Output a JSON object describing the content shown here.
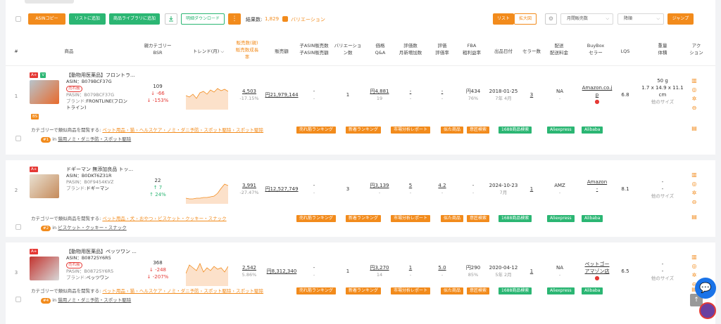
{
  "toolbar": {
    "asin_copy": "ASINコピー",
    "add_list": "リストに追加",
    "add_library": "商品ライブラリに追加",
    "download_icon": "download-icon",
    "detail_download": "明細ダウンロード",
    "more": "⋮",
    "result_label": "結果数:",
    "result_count": "1,829",
    "variation": "バリエーション",
    "view_list": "リスト",
    "view_large": "拡大図",
    "sort_field": "月間販売数",
    "sort_order": "降順",
    "jump": "ジャンプ"
  },
  "headers": {
    "num": "#",
    "product": "商品",
    "parent_bsr": "親カテゴリー",
    "bsr": "BSR",
    "trend": "トレンド(月)",
    "sales_qty": "販売数(親)",
    "sales_growth": "販売数成長",
    "sales_growth2": "率",
    "revenue": "販売額",
    "child_asin": "子ASIN販売数",
    "child_asin2": "子ASIN販売額",
    "variations": "バリエーショ",
    "variations2": "ン数",
    "price": "価格",
    "qa": "Q&A",
    "reviews": "評価数",
    "reviews2": "月新増加数",
    "rating": "評価",
    "rating2": "評価率",
    "fba": "FBA",
    "fba2": "粗利益率",
    "date": "出品日付",
    "sellers": "セラー数",
    "shipping": "配送",
    "shipping2": "配送料金",
    "buybox": "BuyBox",
    "buybox2": "セラー",
    "lqs": "LQS",
    "weight": "重量",
    "weight2": "体積",
    "action": "アク",
    "action2": "ション"
  },
  "rows": [
    {
      "num": "1",
      "badges": [
        "A+",
        "V"
      ],
      "title": "【動物用医薬品】フロントラ...",
      "asin": "ASIN：B079BCF37G",
      "tag": "売れ筋",
      "pasin": "PASIN：B079BCF37G",
      "brand_label": "ブランド:",
      "brand": "FRONTLINE(フロン",
      "brand2": "トライン)",
      "extra": "BS",
      "bsr": "109",
      "bsr_d": "↓ -66",
      "bsr_p": "↓ -153%",
      "sales": "4,503",
      "growth": "-17.15%",
      "revenue": "円21,979,144",
      "child1": "-",
      "child2": "-",
      "var": "1",
      "price": "円4,881",
      "qa": "19",
      "rev": "-",
      "rev2": "-",
      "rate": "-",
      "rate2": "-",
      "fba": "円434",
      "fba2": "76%",
      "date": "2018-01-25",
      "date2": "7年 4月",
      "sellers": "3",
      "ship": "NA",
      "ship2": "-",
      "bb": "Amazon.co.j",
      "bb2": "p",
      "lqs": "6.8",
      "w": "50 g",
      "w2": "1.7 x 14.9 x 11.1",
      "w3": "cm",
      "w4": "他のサイズ",
      "cat_prefix": "カテゴリーで類似商品を閲覧する:",
      "cat_path": "ペット用品 › 猫 › ヘルスケア › ノミ・ダニ予防 › スポット駆除 › スポット駆除",
      "tags": [
        "売れ筋ランキング",
        "新着ランキング",
        "市場分析レポート",
        "似た商品",
        "意匠検索",
        "1688商品検索",
        "Aliexpress",
        "Alibaba"
      ],
      "rank_badge": "#1",
      "rank_in": "in",
      "rank_cat": "猫用ノミ・ダニ予防・スポット駆除"
    },
    {
      "num": "2",
      "badges": [
        "A+"
      ],
      "title": "ドギーマン 無添加良品 トッ...",
      "asin": "ASIN：B0DKT6Z31R",
      "tag": "",
      "pasin": "PASIN：B0F9454KVZ",
      "brand_label": "ブランド:",
      "brand": "ドギーマン",
      "brand2": "",
      "extra": "",
      "bsr": "22",
      "bsr_d": "↑ 7",
      "bsr_p": "↑ 24%",
      "sales": "3,991",
      "growth": "-27.47%",
      "revenue": "円12,527,749",
      "child1": "-",
      "child2": "-",
      "var": "3",
      "price": "円3,139",
      "qa": "-",
      "rev": "5",
      "rev2": "-",
      "rate": "4.2",
      "rate2": "-",
      "fba": "-",
      "fba2": "-",
      "date": "2024-10-23",
      "date2": "7月",
      "sellers": "1",
      "ship": "AMZ",
      "ship2": "-",
      "bb": "Amazon",
      "bb2": "-",
      "lqs": "8.1",
      "w": "-",
      "w2": "-",
      "w3": "",
      "w4": "他のサイズ",
      "cat_prefix": "カテゴリーで類似商品を閲覧する:",
      "cat_path": "ペット用品 › 犬 › おやつ › ビスケット・クッキー・スナック",
      "tags": [
        "売れ筋ランキング",
        "新着ランキング",
        "市場分析レポート",
        "似た商品",
        "意匠検索",
        "1688商品検索",
        "Aliexpress",
        "Alibaba"
      ],
      "rank_badge": "#2",
      "rank_in": "in",
      "rank_cat": "ビスケット・クッキー・スナック"
    },
    {
      "num": "3",
      "badges": [
        "A+"
      ],
      "title": "【動物用医薬品】ペッツワン ...",
      "asin": "ASIN：B08725Y6R5",
      "tag": "売れ筋",
      "pasin": "PASIN：B08725Y6R5",
      "brand_label": "ブランド:",
      "brand": "ペッツワン",
      "brand2": "",
      "extra": "",
      "bsr": "368",
      "bsr_d": "↓ -248",
      "bsr_p": "↓ -207%",
      "sales": "2,542",
      "growth": "5.86%",
      "revenue": "円8,312,340",
      "child1": "-",
      "child2": "-",
      "var": "1",
      "price": "円3,270",
      "qa": "14",
      "rev": "1",
      "rev2": "-",
      "rate": "5.0",
      "rate2": "-",
      "fba": "円290",
      "fba2": "85%",
      "date": "2020-04-12",
      "date2": "5年 2月",
      "sellers": "1",
      "ship": "NA",
      "ship2": "-",
      "bb": "ペットゴー",
      "bb2": "アマゾン店",
      "lqs": "6.5",
      "w": "-",
      "w2": "-",
      "w3": "",
      "w4": "他のサイズ",
      "cat_prefix": "カテゴリーで類似商品を閲覧する:",
      "cat_path": "ペット用品 › 猫 › ヘルスケア › ノミ・ダニ予防 › スポット駆除 › スポット駆除",
      "tags": [
        "売れ筋ランキング",
        "新着ランキング",
        "市場分析レポート",
        "似た商品",
        "意匠検索",
        "1688商品検索",
        "Aliexpress",
        "Alibaba"
      ],
      "rank_badge": "#4",
      "rank_in": "in",
      "rank_cat": "猫用ノミ・ダニ予防・スポット駆除"
    }
  ],
  "colors": {
    "orange": "#f28b1c",
    "green": "#2bb673",
    "red": "#e53935",
    "blue": "#1a73e8"
  },
  "icons": [
    "chat-icon",
    "avatar-icon",
    "back-to-top-icon",
    "settings-icon"
  ]
}
